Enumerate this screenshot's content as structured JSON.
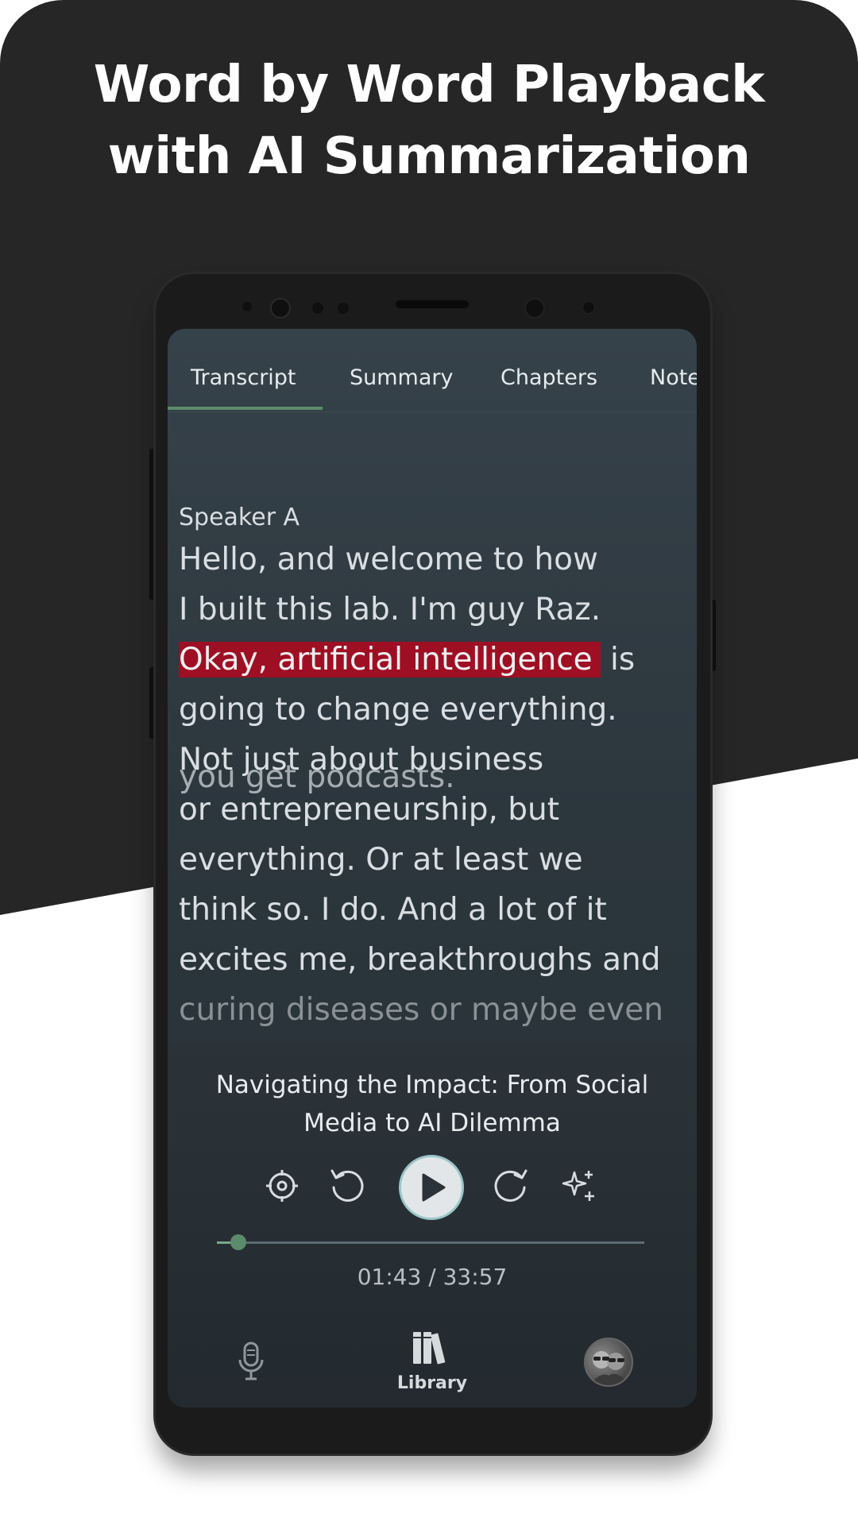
{
  "headline": {
    "line1": "Word by Word Playback",
    "line2": "with AI Summarization"
  },
  "tabs": [
    {
      "label": "Transcript",
      "active": true
    },
    {
      "label": "Summary",
      "active": false
    },
    {
      "label": "Chapters",
      "active": false
    },
    {
      "label": "Note",
      "active": false
    }
  ],
  "transcript": {
    "previous_line": "you get podcasts.",
    "speaker": "Speaker A",
    "lines": [
      "Hello, and welcome to how",
      "I built this lab. I'm guy Raz.",
      "going to change everything.",
      "Not just about business",
      "or entrepreneurship, but",
      "everything. Or at least we",
      "think so. I do. And a lot of it",
      "excites me, breakthroughs and",
      "curing diseases or maybe even"
    ],
    "highlighted_text": "Okay, artificial intelligence",
    "highlighted_rest": " is",
    "highlight_color": "#9e0f24"
  },
  "player": {
    "episode_title_line1": "Navigating the Impact: From Social",
    "episode_title_line2": "Media to AI Dilemma",
    "controls": [
      "target-icon",
      "rewind-icon",
      "play-icon",
      "forward-icon",
      "sparkle-icon"
    ],
    "time_display": "01:43 / 33:57",
    "progress": 0.05
  },
  "nav": {
    "items": [
      {
        "name": "microphone-icon"
      },
      {
        "name": "library-icon",
        "label": "Library",
        "active": true
      },
      {
        "name": "profile-avatar"
      }
    ]
  },
  "colors": {
    "accent": "#5b8b6b",
    "background_dark": "#262626",
    "screen_bg": "#2c363d"
  }
}
